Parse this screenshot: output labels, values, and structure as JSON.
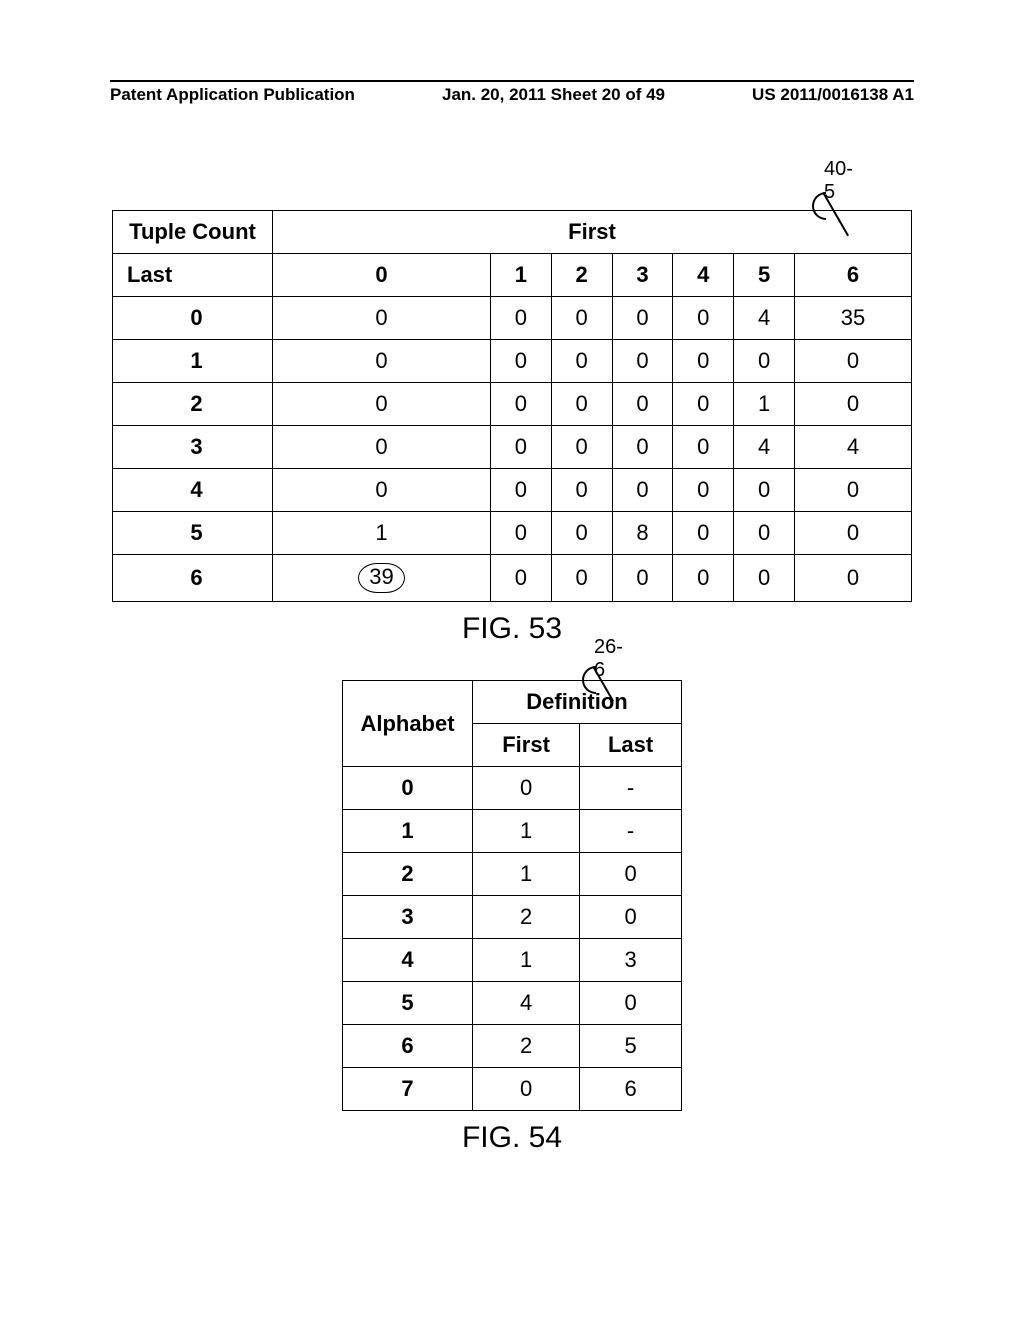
{
  "header": {
    "left": "Patent Application Publication",
    "center": "Jan. 20, 2011  Sheet 20 of 49",
    "right": "US 2011/0016138 A1"
  },
  "fig53": {
    "ref": "40-5",
    "title_corner": "Tuple Count",
    "col_group_label": "First",
    "row_group_label": "Last",
    "col_headers": [
      "0",
      "1",
      "2",
      "3",
      "4",
      "5",
      "6"
    ],
    "row_headers": [
      "0",
      "1",
      "2",
      "3",
      "4",
      "5",
      "6"
    ],
    "rows": [
      [
        "0",
        "0",
        "0",
        "0",
        "0",
        "4",
        "35"
      ],
      [
        "0",
        "0",
        "0",
        "0",
        "0",
        "0",
        "0"
      ],
      [
        "0",
        "0",
        "0",
        "0",
        "0",
        "1",
        "0"
      ],
      [
        "0",
        "0",
        "0",
        "0",
        "0",
        "4",
        "4"
      ],
      [
        "0",
        "0",
        "0",
        "0",
        "0",
        "0",
        "0"
      ],
      [
        "1",
        "0",
        "0",
        "8",
        "0",
        "0",
        "0"
      ],
      [
        "39",
        "0",
        "0",
        "0",
        "0",
        "0",
        "0"
      ]
    ],
    "circled_cell": {
      "row": 6,
      "col": 0
    },
    "caption": "FIG. 53"
  },
  "fig54": {
    "ref": "26-6",
    "left_header": "Alphabet",
    "group_header": "Definition",
    "sub_headers": [
      "First",
      "Last"
    ],
    "rows": [
      [
        "0",
        "0",
        "-"
      ],
      [
        "1",
        "1",
        "-"
      ],
      [
        "2",
        "1",
        "0"
      ],
      [
        "3",
        "2",
        "0"
      ],
      [
        "4",
        "1",
        "3"
      ],
      [
        "5",
        "4",
        "0"
      ],
      [
        "6",
        "2",
        "5"
      ],
      [
        "7",
        "0",
        "6"
      ]
    ],
    "caption": "FIG. 54"
  }
}
